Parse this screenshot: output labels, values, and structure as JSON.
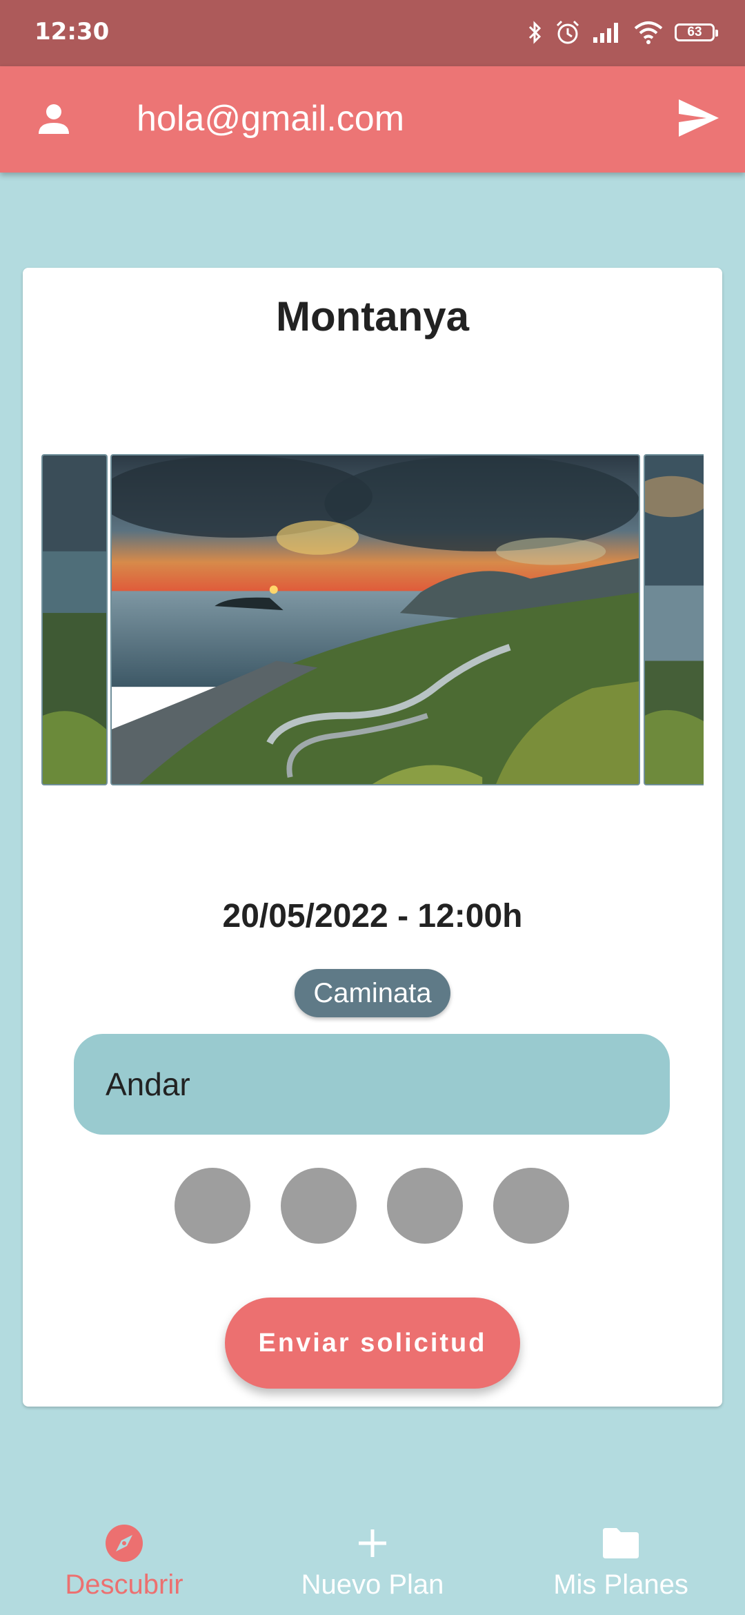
{
  "status_bar": {
    "time": "12:30",
    "battery": "63",
    "icons": [
      "bluetooth-icon",
      "alarm-icon",
      "signal-icon",
      "wifi-icon",
      "battery-icon"
    ]
  },
  "app_bar": {
    "email": "hola@gmail.com",
    "left_icon": "person-icon",
    "right_icon": "send-icon"
  },
  "plan": {
    "title": "Montanya",
    "datetime": "20/05/2022 - 12:00h",
    "category": "Caminata",
    "description": "Andar",
    "participants": 4,
    "action_label": "Enviar solicitud"
  },
  "bottom_nav": {
    "items": [
      {
        "label": "Descubrir",
        "icon": "compass-icon",
        "active": true
      },
      {
        "label": "Nuevo Plan",
        "icon": "plus-icon",
        "active": false
      },
      {
        "label": "Mis Planes",
        "icon": "folder-icon",
        "active": false
      }
    ]
  },
  "colors": {
    "accent": "#ec7575",
    "status_bar": "#ad5a5a",
    "background": "#b3dbdf",
    "chip": "#5f7a87",
    "description_field": "#99cacf",
    "avatar_placeholder": "#9e9e9e"
  }
}
